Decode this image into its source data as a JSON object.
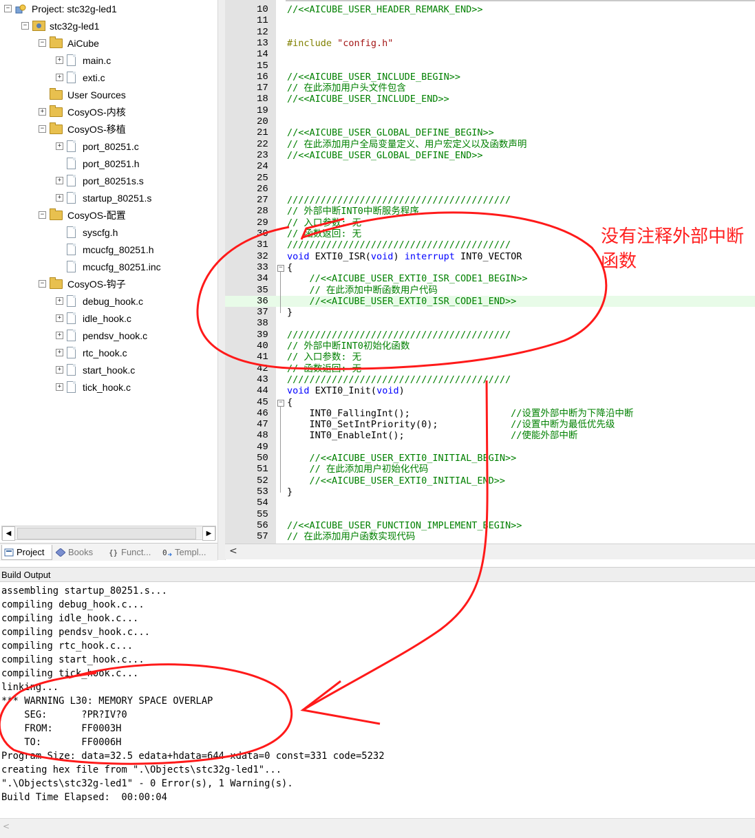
{
  "project_tree": {
    "items": [
      {
        "label": "Project: stc32g-led1",
        "kind": "project",
        "level": 0,
        "toggle": "−"
      },
      {
        "label": "stc32g-led1",
        "kind": "target",
        "level": 1,
        "toggle": "−"
      },
      {
        "label": "AiCube",
        "kind": "folder",
        "level": 2,
        "toggle": "−"
      },
      {
        "label": "main.c",
        "kind": "file",
        "level": 3,
        "toggle": "+"
      },
      {
        "label": "exti.c",
        "kind": "file",
        "level": 3,
        "toggle": "+"
      },
      {
        "label": "User Sources",
        "kind": "folder",
        "level": 2,
        "toggle": ""
      },
      {
        "label": "CosyOS-内核",
        "kind": "folder",
        "level": 2,
        "toggle": "+"
      },
      {
        "label": "CosyOS-移植",
        "kind": "folder",
        "level": 2,
        "toggle": "−"
      },
      {
        "label": "port_80251.c",
        "kind": "file",
        "level": 3,
        "toggle": "+"
      },
      {
        "label": "port_80251.h",
        "kind": "file",
        "level": 3,
        "toggle": ""
      },
      {
        "label": "port_80251s.s",
        "kind": "file",
        "level": 3,
        "toggle": "+"
      },
      {
        "label": "startup_80251.s",
        "kind": "file",
        "level": 3,
        "toggle": "+"
      },
      {
        "label": "CosyOS-配置",
        "kind": "folder",
        "level": 2,
        "toggle": "−"
      },
      {
        "label": "syscfg.h",
        "kind": "file",
        "level": 3,
        "toggle": ""
      },
      {
        "label": "mcucfg_80251.h",
        "kind": "file",
        "level": 3,
        "toggle": ""
      },
      {
        "label": "mcucfg_80251.inc",
        "kind": "file",
        "level": 3,
        "toggle": ""
      },
      {
        "label": "CosyOS-钩子",
        "kind": "folder",
        "level": 2,
        "toggle": "−"
      },
      {
        "label": "debug_hook.c",
        "kind": "file",
        "level": 3,
        "toggle": "+"
      },
      {
        "label": "idle_hook.c",
        "kind": "file",
        "level": 3,
        "toggle": "+"
      },
      {
        "label": "pendsv_hook.c",
        "kind": "file",
        "level": 3,
        "toggle": "+"
      },
      {
        "label": "rtc_hook.c",
        "kind": "file",
        "level": 3,
        "toggle": "+"
      },
      {
        "label": "start_hook.c",
        "kind": "file",
        "level": 3,
        "toggle": "+"
      },
      {
        "label": "tick_hook.c",
        "kind": "file",
        "level": 3,
        "toggle": "+"
      }
    ]
  },
  "panel_tabs": [
    {
      "label": "Project",
      "icon": "project-icon",
      "active": true
    },
    {
      "label": "Books",
      "icon": "books-icon",
      "active": false
    },
    {
      "label": "Funct...",
      "icon": "functions-icon",
      "active": false
    },
    {
      "label": "Templ...",
      "icon": "templates-icon",
      "active": false
    }
  ],
  "scroll_glyphs": {
    "left": "◀",
    "right": "▶",
    "editor_left": "<",
    "build_left": "<"
  },
  "editor": {
    "lines": [
      {
        "n": "10",
        "segs": [
          {
            "c": "cm",
            "t": "//<<AICUBE_USER_HEADER_REMARK_END>>"
          }
        ]
      },
      {
        "n": "11",
        "segs": []
      },
      {
        "n": "12",
        "segs": []
      },
      {
        "n": "13",
        "segs": [
          {
            "c": "pp",
            "t": "#include "
          },
          {
            "c": "str",
            "t": "\"config.h\""
          }
        ]
      },
      {
        "n": "14",
        "segs": []
      },
      {
        "n": "15",
        "segs": []
      },
      {
        "n": "16",
        "segs": [
          {
            "c": "cm",
            "t": "//<<AICUBE_USER_INCLUDE_BEGIN>>"
          }
        ]
      },
      {
        "n": "17",
        "segs": [
          {
            "c": "cm",
            "t": "// 在此添加用户头文件包含"
          }
        ]
      },
      {
        "n": "18",
        "segs": [
          {
            "c": "cm",
            "t": "//<<AICUBE_USER_INCLUDE_END>>"
          }
        ]
      },
      {
        "n": "19",
        "segs": []
      },
      {
        "n": "20",
        "segs": []
      },
      {
        "n": "21",
        "segs": [
          {
            "c": "cm",
            "t": "//<<AICUBE_USER_GLOBAL_DEFINE_BEGIN>>"
          }
        ]
      },
      {
        "n": "22",
        "segs": [
          {
            "c": "cm",
            "t": "// 在此添加用户全局变量定义、用户宏定义以及函数声明"
          }
        ]
      },
      {
        "n": "23",
        "segs": [
          {
            "c": "cm",
            "t": "//<<AICUBE_USER_GLOBAL_DEFINE_END>>"
          }
        ]
      },
      {
        "n": "24",
        "segs": []
      },
      {
        "n": "25",
        "segs": []
      },
      {
        "n": "26",
        "segs": []
      },
      {
        "n": "27",
        "segs": [
          {
            "c": "cm",
            "t": "////////////////////////////////////////"
          }
        ]
      },
      {
        "n": "28",
        "segs": [
          {
            "c": "cm",
            "t": "// 外部中断INT0中断服务程序"
          }
        ]
      },
      {
        "n": "29",
        "segs": [
          {
            "c": "cm",
            "t": "// 入口参数: 无"
          }
        ]
      },
      {
        "n": "30",
        "segs": [
          {
            "c": "cm",
            "t": "// 函数返回: 无"
          }
        ]
      },
      {
        "n": "31",
        "segs": [
          {
            "c": "cm",
            "t": "////////////////////////////////////////"
          }
        ]
      },
      {
        "n": "32",
        "segs": [
          {
            "c": "kw",
            "t": "void"
          },
          {
            "c": "",
            "t": " EXTI0_ISR("
          },
          {
            "c": "kw",
            "t": "void"
          },
          {
            "c": "",
            "t": ") "
          },
          {
            "c": "kw",
            "t": "interrupt"
          },
          {
            "c": "",
            "t": " INT0_VECTOR"
          }
        ]
      },
      {
        "n": "33",
        "fold": "−",
        "segs": [
          {
            "c": "",
            "t": "{"
          }
        ]
      },
      {
        "n": "34",
        "segs": [
          {
            "c": "cm",
            "t": "    //<<AICUBE_USER_EXTI0_ISR_CODE1_BEGIN>>"
          }
        ]
      },
      {
        "n": "35",
        "segs": [
          {
            "c": "cm",
            "t": "    // 在此添加中断函数用户代码"
          }
        ]
      },
      {
        "n": "36",
        "hl": true,
        "segs": [
          {
            "c": "cm",
            "t": "    //<<AICUBE_USER_EXTI0_ISR_CODE1_END>>"
          }
        ]
      },
      {
        "n": "37",
        "segs": [
          {
            "c": "",
            "t": "}"
          }
        ]
      },
      {
        "n": "38",
        "segs": []
      },
      {
        "n": "39",
        "segs": [
          {
            "c": "cm",
            "t": "////////////////////////////////////////"
          }
        ]
      },
      {
        "n": "40",
        "segs": [
          {
            "c": "cm",
            "t": "// 外部中断INT0初始化函数"
          }
        ]
      },
      {
        "n": "41",
        "segs": [
          {
            "c": "cm",
            "t": "// 入口参数: 无"
          }
        ]
      },
      {
        "n": "42",
        "segs": [
          {
            "c": "cm",
            "t": "// 函数返回: 无"
          }
        ]
      },
      {
        "n": "43",
        "segs": [
          {
            "c": "cm",
            "t": "////////////////////////////////////////"
          }
        ]
      },
      {
        "n": "44",
        "segs": [
          {
            "c": "kw",
            "t": "void"
          },
          {
            "c": "",
            "t": " EXTI0_Init("
          },
          {
            "c": "kw",
            "t": "void"
          },
          {
            "c": "",
            "t": ")"
          }
        ]
      },
      {
        "n": "45",
        "fold": "−",
        "segs": [
          {
            "c": "",
            "t": "{"
          }
        ]
      },
      {
        "n": "46",
        "segs": [
          {
            "c": "",
            "t": "    INT0_FallingInt();                  "
          },
          {
            "c": "cm",
            "t": "//设置外部中断为下降沿中断"
          }
        ]
      },
      {
        "n": "47",
        "segs": [
          {
            "c": "",
            "t": "    INT0_SetIntPriority(0);             "
          },
          {
            "c": "cm",
            "t": "//设置中断为最低优先级"
          }
        ]
      },
      {
        "n": "48",
        "segs": [
          {
            "c": "",
            "t": "    INT0_EnableInt();                   "
          },
          {
            "c": "cm",
            "t": "//使能外部中断"
          }
        ]
      },
      {
        "n": "49",
        "segs": []
      },
      {
        "n": "50",
        "segs": [
          {
            "c": "cm",
            "t": "    //<<AICUBE_USER_EXTI0_INITIAL_BEGIN>>"
          }
        ]
      },
      {
        "n": "51",
        "segs": [
          {
            "c": "cm",
            "t": "    // 在此添加用户初始化代码"
          }
        ]
      },
      {
        "n": "52",
        "segs": [
          {
            "c": "cm",
            "t": "    //<<AICUBE_USER_EXTI0_INITIAL_END>>"
          }
        ]
      },
      {
        "n": "53",
        "segs": [
          {
            "c": "",
            "t": "}"
          }
        ]
      },
      {
        "n": "54",
        "segs": []
      },
      {
        "n": "55",
        "segs": []
      },
      {
        "n": "56",
        "segs": [
          {
            "c": "cm",
            "t": "//<<AICUBE_USER_FUNCTION_IMPLEMENT_BEGIN>>"
          }
        ]
      },
      {
        "n": "57",
        "segs": [
          {
            "c": "cm",
            "t": "// 在此添加用户函数实现代码"
          }
        ]
      }
    ]
  },
  "build_output": {
    "title": "Build Output",
    "lines": [
      "assembling startup_80251.s...",
      "compiling debug_hook.c...",
      "compiling idle_hook.c...",
      "compiling pendsv_hook.c...",
      "compiling rtc_hook.c...",
      "compiling start_hook.c...",
      "compiling tick_hook.c...",
      "linking...",
      "*** WARNING L30: MEMORY SPACE OVERLAP",
      "    SEG:      ?PR?IV?0",
      "    FROM:     FF0003H",
      "    TO:       FF0006H",
      "Program Size: data=32.5 edata+hdata=644 xdata=0 const=331 code=5232",
      "creating hex file from \".\\Objects\\stc32g-led1\"...",
      "\".\\Objects\\stc32g-led1\" - 0 Error(s), 1 Warning(s).",
      "Build Time Elapsed:  00:00:04"
    ]
  },
  "annotation": {
    "text": "没有注释外部中断函数",
    "color": "#ff2020"
  }
}
